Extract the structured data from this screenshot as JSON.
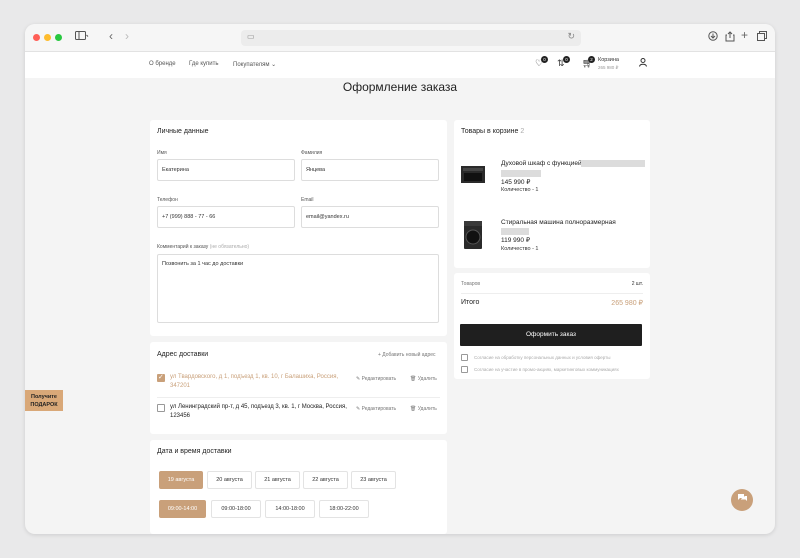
{
  "browser": {
    "sidebar_icon": "sidebar-icon",
    "back_icon": "chevron-left-icon",
    "forward_icon": "chevron-right-icon",
    "toolbar_icons": [
      "download-icon",
      "share-icon",
      "new-tab-icon",
      "tabs-icon"
    ]
  },
  "nav": {
    "items": [
      "О бренде",
      "Где купить",
      "Покупателям"
    ],
    "cart_label": "Корзина",
    "cart_sum": "265 980 ₽",
    "favorites_count": "0",
    "compare_count": "0",
    "cart_count": "2"
  },
  "page": {
    "title": "Оформление заказа"
  },
  "personal": {
    "title": "Личные данные",
    "first_name_label": "Имя",
    "first_name_value": "Екатерина",
    "last_name_label": "Фамилия",
    "last_name_value": "Янцева",
    "phone_label": "Телефон",
    "phone_value": "+7 (999) 888 - 77 - 66",
    "email_label": "Email",
    "email_value": "email@yandex.ru",
    "comment_label": "Комментарий к заказу",
    "comment_optional": "(не обязательно)",
    "comment_value": "Позвонить за 1 час до доставки"
  },
  "delivery": {
    "title": "Адрес доставки",
    "add_label": "+ Добавить новый адрес",
    "addresses": [
      {
        "text": "ул Твардовского, д 1, подъезд 1, кв. 10, г Балашиха, Россия, 347201",
        "checked": true
      },
      {
        "text": "ул Ленинградский пр-т, д 45, подъезд 3, кв. 1, г Москва, Россия, 123456",
        "checked": false
      }
    ],
    "edit_label": "Редактировать",
    "delete_label": "Удалить"
  },
  "datetime": {
    "title": "Дата и время доставки",
    "dates": [
      "19 августа",
      "20 августа",
      "21 августа",
      "22 августа",
      "23 августа"
    ],
    "selected_date": "19 августа",
    "times": [
      "09:00-14:00",
      "09:00-18:00",
      "14:00-18:00",
      "18:00-22:00"
    ],
    "selected_time": "09:00-14:00"
  },
  "cart": {
    "title": "Товары в корзине",
    "count": "2",
    "items": [
      {
        "name": "Духовой шкаф с функцией",
        "price": "145 990 ₽",
        "qty": "Количество - 1"
      },
      {
        "name": "Стиральная машина полноразмерная",
        "price": "119 990 ₽",
        "qty": "Количество - 1"
      }
    ]
  },
  "summary": {
    "goods_label": "Товаров",
    "goods_value": "2 шт.",
    "total_label": "Итого",
    "total_value": "265 980 ₽",
    "order_button": "Оформить заказ",
    "consent1": "Согласие на обработку персональных данных и условия оферты",
    "consent2": "Согласие на участие в промо-акциях, маркетинговых коммуникациях"
  },
  "gift": {
    "line1": "Получите",
    "line2": "ПОДАРОК"
  },
  "colors": {
    "accent": "#c9a07a",
    "dark": "#1f1f1f",
    "price": "#c9a07a"
  }
}
